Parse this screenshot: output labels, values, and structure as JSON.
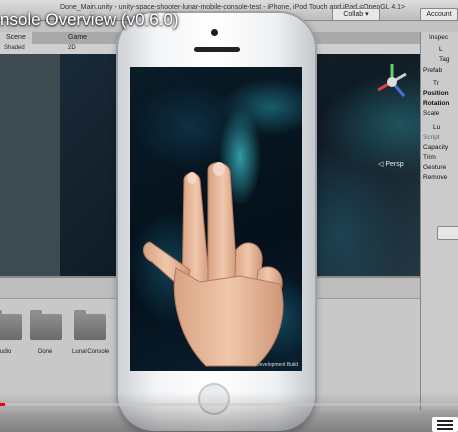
{
  "video": {
    "title": "nsole Overview (v0.6.0)",
    "progress": 0.01
  },
  "editor": {
    "window_title": "Done_Main.unity - unity-space-shooter-lunar-mobile-console-test - iPhone, iPod Touch and iPad <OpenGL 4.1>",
    "collab_label": "Collab ▾",
    "account_label": "Account",
    "tabs": [
      "Scene",
      "Game"
    ],
    "scene_toolbar": {
      "shading": "Shaded",
      "mode": "2D"
    },
    "persp_label": "◁ Persp"
  },
  "inspector": {
    "tab_label": "Inspec",
    "rows": [
      "L",
      "Tag",
      "Prefab",
      "Tr",
      "Position",
      "Rotation",
      "Scale",
      "Lu",
      "Script",
      "Capacity",
      "Trim",
      "Gesture",
      "Remove"
    ]
  },
  "project": {
    "folders": [
      "udio",
      "Done",
      "LunarConsole"
    ]
  },
  "phone_screen": {
    "development_build": "Development Build"
  },
  "icons": {
    "menu": "menu-list-icon",
    "gizmo": "scene-gizmo-icon",
    "folder": "folder-icon"
  },
  "colors": {
    "progress": "#ff0000",
    "nebula": "#3cbec8"
  }
}
